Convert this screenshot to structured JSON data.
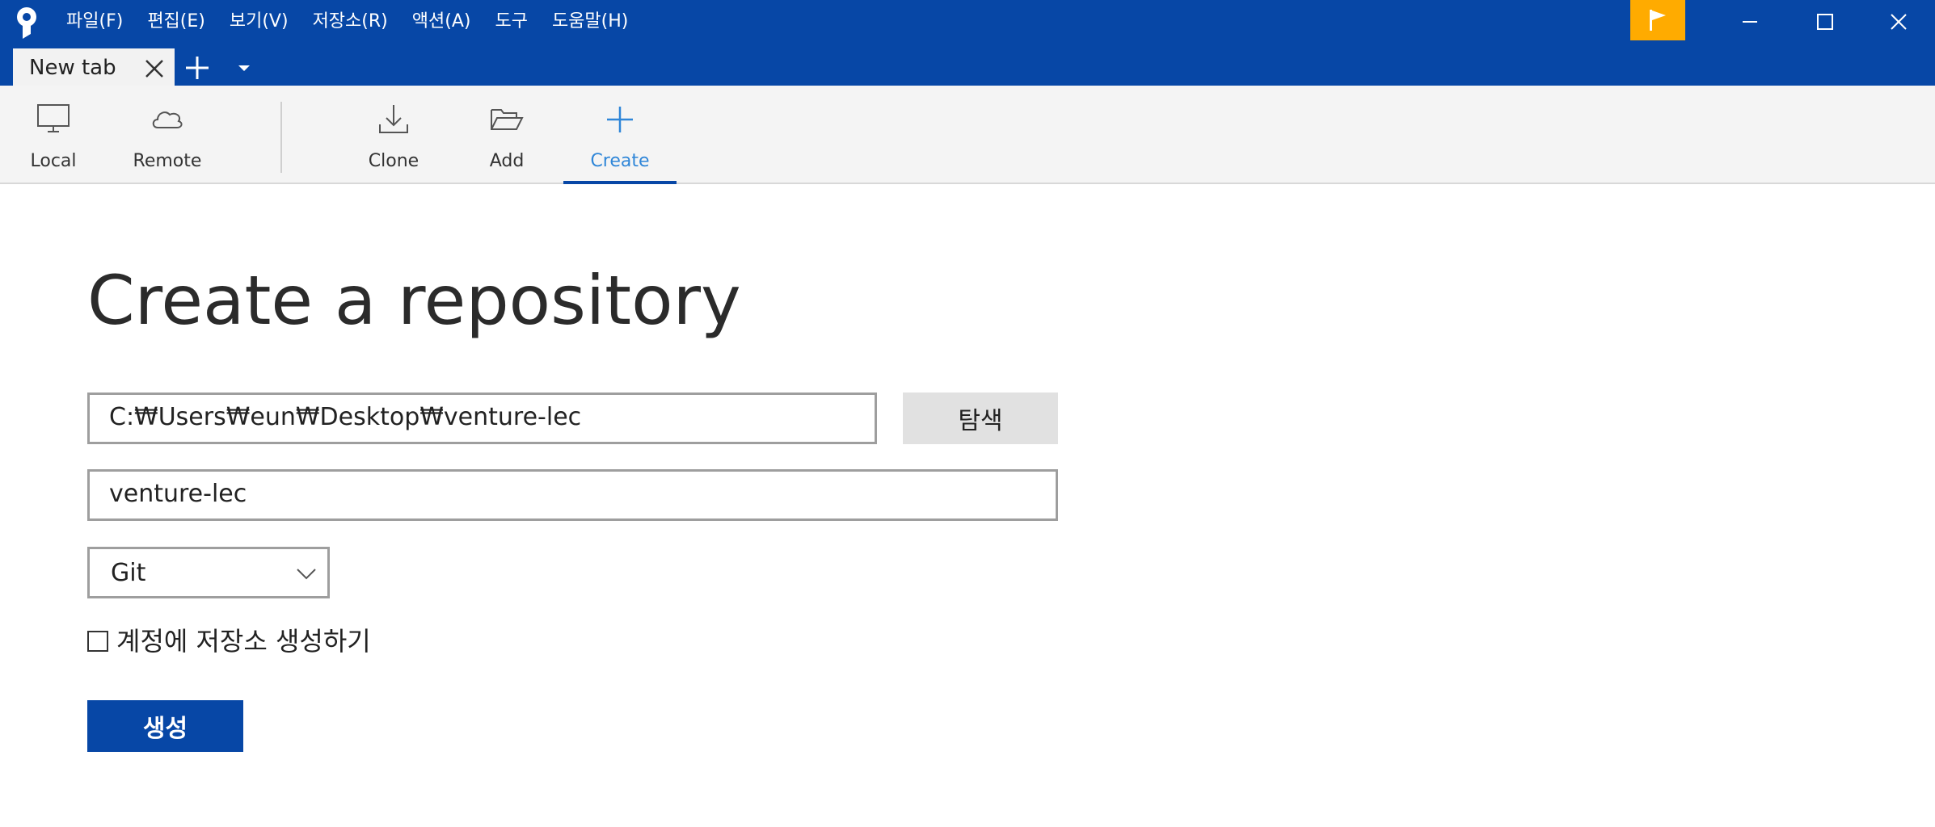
{
  "window": {
    "menu": [
      "파일(F)",
      "편집(E)",
      "보기(V)",
      "저장소(R)",
      "액션(A)",
      "도구",
      "도움말(H)"
    ],
    "accent_color": "#0747a6",
    "flag_color": "#ffab00"
  },
  "tabs": [
    {
      "label": "New tab"
    }
  ],
  "toolbar": {
    "items": [
      {
        "label": "Local",
        "icon": "monitor-icon"
      },
      {
        "label": "Remote",
        "icon": "cloud-icon"
      },
      {
        "label": "Clone",
        "icon": "download-icon"
      },
      {
        "label": "Add",
        "icon": "folder-open-icon"
      },
      {
        "label": "Create",
        "icon": "plus-icon",
        "active": true
      }
    ]
  },
  "main": {
    "title": "Create a repository",
    "path_value": "C:₩Users₩eun₩Desktop₩venture-lec",
    "browse_label": "탐색",
    "name_value": "venture-lec",
    "repo_type": "Git",
    "account_checkbox_label": "계정에 저장소 생성하기",
    "account_checkbox_checked": false,
    "create_label": "생성"
  }
}
